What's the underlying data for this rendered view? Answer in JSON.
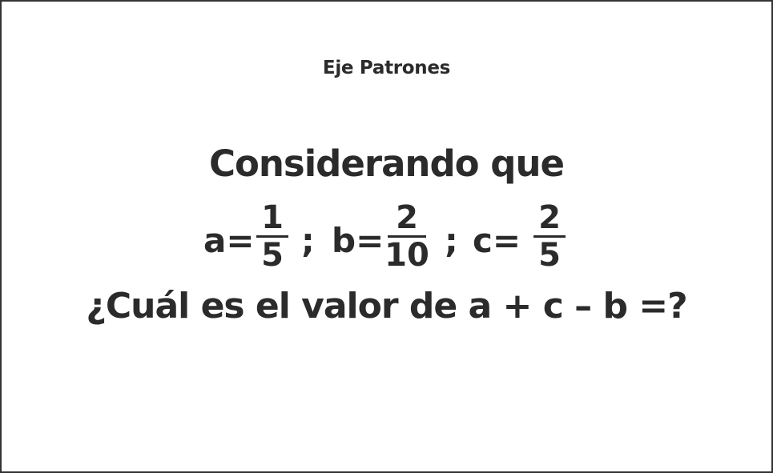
{
  "header": {
    "title": "Eje Patrones"
  },
  "question": {
    "intro": "Considerando que",
    "a_label": "a=",
    "a_num": "1",
    "a_den": "5",
    "sep1": ";",
    "b_label": "b=",
    "b_num": "2",
    "b_den": "10",
    "sep2": ";",
    "c_label": "c=",
    "c_num": "2",
    "c_den": "5",
    "prompt": "¿Cuál es el valor de a + c – b =?"
  }
}
